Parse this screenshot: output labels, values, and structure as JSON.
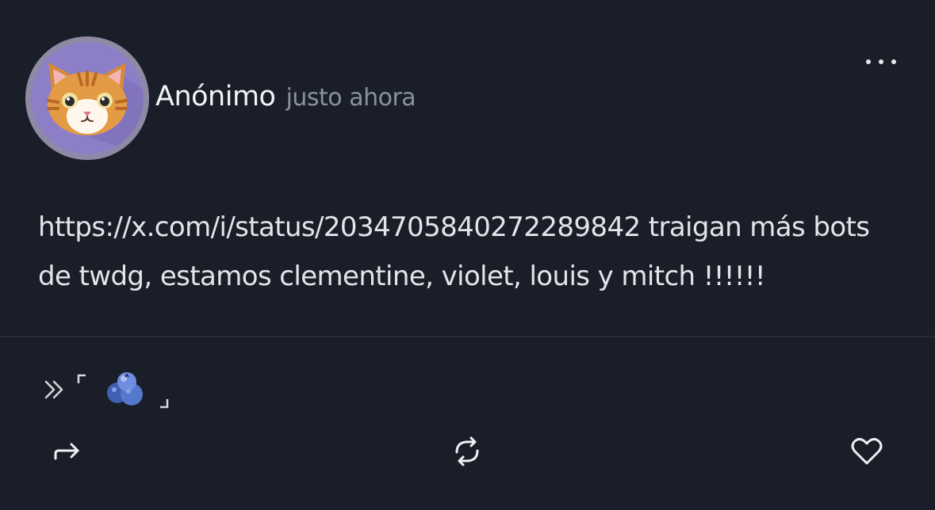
{
  "post": {
    "author": "Anónimo",
    "time": "justo ahora",
    "text": "https://x.com/i/status/2034705840272289842 traigan más bots de twdg, estamos clementine, violet, louis y mitch !!!!!!"
  },
  "icons": {
    "avatar": "cat-avatar",
    "more": "more-options-icon",
    "tag": "double-chevron-bracket-blueberry",
    "share": "share-arrow-icon",
    "repost": "repost-icon",
    "like": "heart-icon"
  },
  "colors": {
    "background": "#1a1e28",
    "text": "#e3e5ea",
    "muted": "#8a90a0",
    "avatar_bg": "#8c7ec7"
  }
}
